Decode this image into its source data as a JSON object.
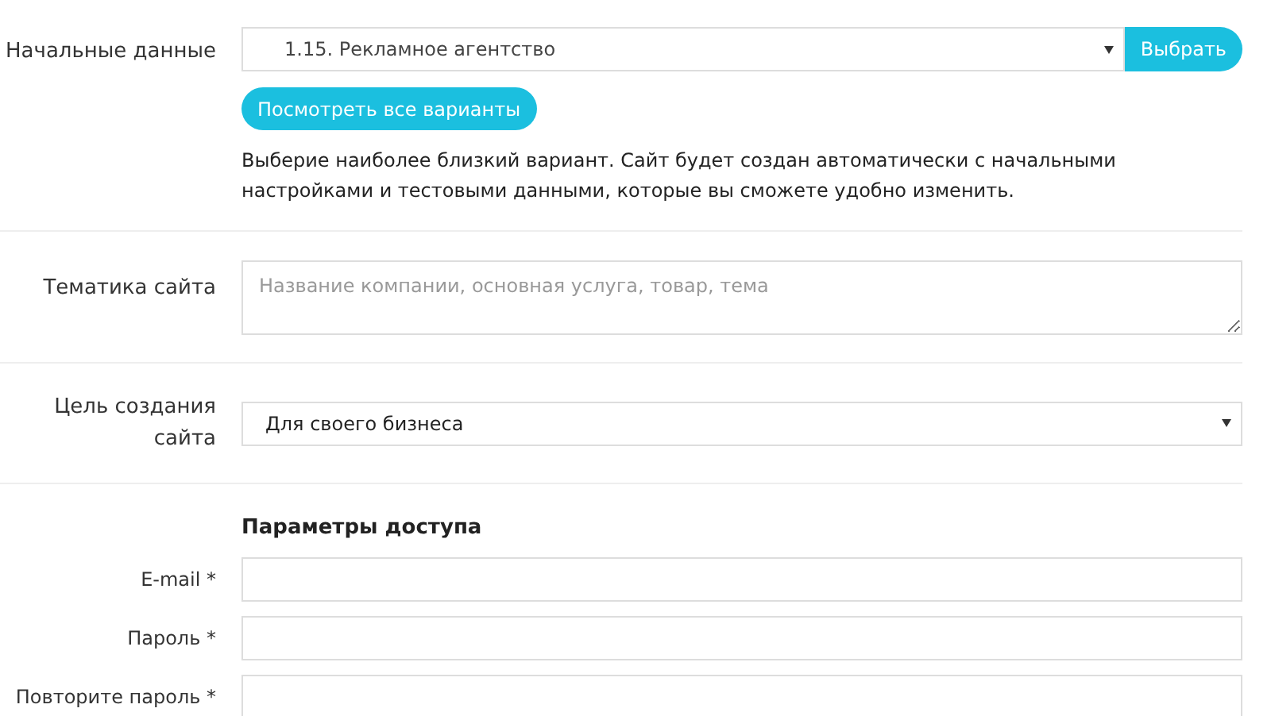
{
  "initial_data": {
    "label": "Начальные данные",
    "select": {
      "value": "1.15. Рекламное агентство"
    },
    "choose_button": "Выбрать",
    "view_all_button": "Посмотреть все варианты",
    "hint": "Выберие наиболее близкий вариант. Сайт будет создан автоматически с начальными настройками и тестовыми данными, которые вы сможете удобно изменить."
  },
  "topic": {
    "label": "Тематика сайта",
    "placeholder": "Название компании, основная услуга, товар, тема"
  },
  "goal": {
    "label": "Цель создания сайта",
    "select": {
      "value": "Для своего бизнеса"
    }
  },
  "access": {
    "heading": "Параметры доступа",
    "fields": [
      {
        "label": "E-mail *"
      },
      {
        "label": "Пароль *"
      },
      {
        "label": "Повторите пароль *"
      }
    ]
  }
}
